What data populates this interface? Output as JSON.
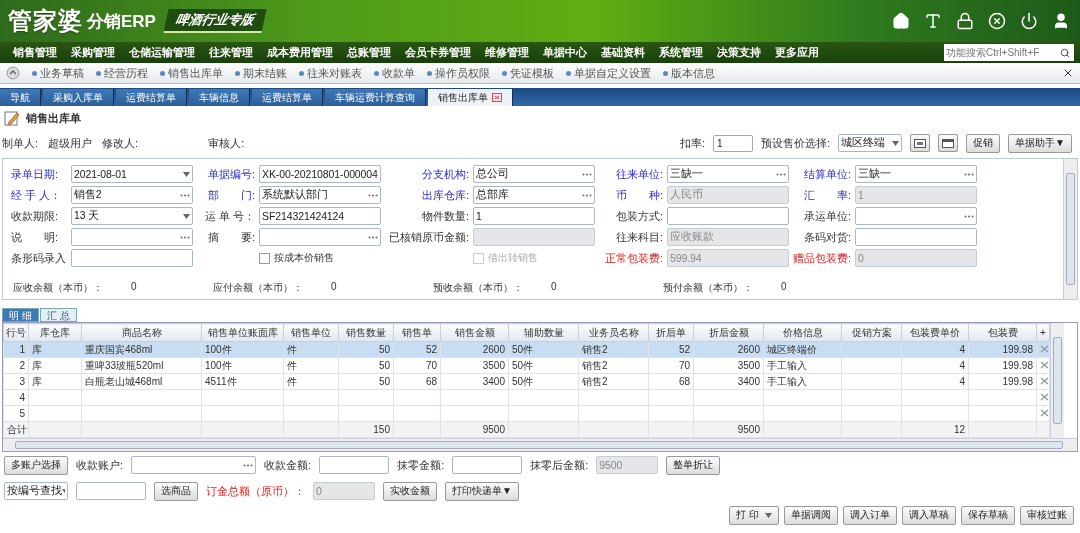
{
  "header": {
    "logo": "管家婆",
    "product": "分销ERP",
    "edition": "啤酒行业专版"
  },
  "menu": [
    "销售管理",
    "采购管理",
    "仓储运输管理",
    "往来管理",
    "成本费用管理",
    "总账管理",
    "会员卡券管理",
    "维修管理",
    "单据中心",
    "基础资料",
    "系统管理",
    "决策支持",
    "更多应用"
  ],
  "search": {
    "placeholder": "功能搜索Ctrl+Shift+F"
  },
  "quick_links": [
    "业务草稿",
    "经营历程",
    "销售出库单",
    "期末结账",
    "往来对账表",
    "收款单",
    "操作员权限",
    "凭证模板",
    "单据自定义设置",
    "版本信息"
  ],
  "tabs": [
    {
      "label": "导航",
      "selected": false,
      "closable": false
    },
    {
      "label": "采购入库单",
      "selected": false,
      "closable": false
    },
    {
      "label": "运费结算单",
      "selected": false,
      "closable": false
    },
    {
      "label": "车辆信息",
      "selected": false,
      "closable": false
    },
    {
      "label": "运费结算单",
      "selected": false,
      "closable": false
    },
    {
      "label": "车辆运费计算查询",
      "selected": false,
      "closable": false
    },
    {
      "label": "销售出库单",
      "selected": true,
      "closable": true
    }
  ],
  "document": {
    "title": "销售出库单",
    "creator_label": "制单人:",
    "creator": "超级用户",
    "modifier_label": "修改人:",
    "reviewer_label": "审核人:"
  },
  "toolbar": {
    "discount_label": "扣率:",
    "discount": "1",
    "price_label": "预设售价选择:",
    "price": "城区终端",
    "buttons": [
      "促销",
      "单据助手▼"
    ]
  },
  "form": {
    "rows": [
      {
        "cells": [
          {
            "label": "录单日期:",
            "required": true,
            "fee": false,
            "field": {
              "kind": "select",
              "value": "2021-08-01",
              "disabled": false
            }
          },
          {
            "label": "单据编号:",
            "required": true,
            "fee": false,
            "field": {
              "kind": "text",
              "value": "XK-00-20210801-000004",
              "disabled": false
            }
          },
          {
            "label": "分支机构:",
            "required": true,
            "fee": false,
            "field": {
              "kind": "picker",
              "value": "总公司",
              "disabled": false
            }
          },
          {
            "label": "往来单位:",
            "required": true,
            "fee": false,
            "field": {
              "kind": "picker",
              "value": "三缺一",
              "disabled": false
            }
          },
          {
            "label": "结算单位:",
            "required": true,
            "fee": false,
            "field": {
              "kind": "picker",
              "value": "三缺一",
              "disabled": false
            }
          }
        ]
      },
      {
        "cells": [
          {
            "label": "经 手 人：",
            "required": true,
            "fee": false,
            "field": {
              "kind": "picker",
              "value": "销售2",
              "disabled": false
            }
          },
          {
            "label": "部　　门:",
            "required": true,
            "fee": false,
            "field": {
              "kind": "picker",
              "value": "系统默认部门",
              "disabled": false
            }
          },
          {
            "label": "出库仓库:",
            "required": true,
            "fee": false,
            "field": {
              "kind": "picker",
              "value": "总部库",
              "disabled": false
            }
          },
          {
            "label": "币　　种:",
            "required": true,
            "fee": false,
            "field": {
              "kind": "select",
              "value": "人民币",
              "disabled": true
            }
          },
          {
            "label": "汇　　率:",
            "required": true,
            "fee": false,
            "field": {
              "kind": "text",
              "value": "1",
              "disabled": true
            }
          }
        ]
      },
      {
        "cells": [
          {
            "label": "收款期限:",
            "required": false,
            "fee": false,
            "field": {
              "kind": "select",
              "value": "13 天",
              "disabled": false
            }
          },
          {
            "label": "运 单 号：",
            "required": false,
            "fee": false,
            "field": {
              "kind": "text",
              "value": "SF214321424124",
              "disabled": false
            }
          },
          {
            "label": "物件数量:",
            "required": false,
            "fee": false,
            "field": {
              "kind": "text",
              "value": "1",
              "disabled": false
            }
          },
          {
            "label": "包装方式:",
            "required": false,
            "fee": false,
            "field": {
              "kind": "text",
              "disabled": false
            }
          },
          {
            "label": "承运单位:",
            "required": false,
            "fee": false,
            "field": {
              "kind": "picker",
              "disabled": false
            }
          }
        ]
      },
      {
        "cells": [
          {
            "label": "说　　明:",
            "required": false,
            "fee": false,
            "field": {
              "kind": "picker",
              "disabled": false
            }
          },
          {
            "label": "摘　　要:",
            "required": false,
            "fee": false,
            "field": {
              "kind": "picker",
              "disabled": false
            }
          },
          {
            "label": "已核销原币金额:",
            "required": false,
            "fee": false,
            "field": {
              "kind": "text",
              "disabled": true
            }
          },
          {
            "label": "往来科目:",
            "required": false,
            "fee": false,
            "field": {
              "kind": "select",
              "value": "应收账款",
              "disabled": true
            }
          },
          {
            "label": "条码对货:",
            "required": false,
            "fee": false,
            "field": {
              "kind": "text",
              "disabled": false
            }
          }
        ]
      },
      {
        "cells": [
          {
            "label": "条形码录入",
            "required": false,
            "fee": false,
            "field": {
              "kind": "text",
              "disabled": false
            }
          },
          {
            "field": {
              "kind": "checkbox",
              "label": "按成本价销售",
              "checked": false,
              "disabled": false
            }
          },
          {
            "field": {
              "kind": "checkbox",
              "label": "借出转销售",
              "checked": false,
              "disabled": true
            }
          },
          {
            "label": "正常包装费:",
            "required": false,
            "fee": true,
            "field": {
              "kind": "text",
              "value": "599.94",
              "disabled": true
            }
          },
          {
            "label": "赠品包装费:",
            "required": false,
            "fee": true,
            "field": {
              "kind": "text",
              "value": "0",
              "disabled": true
            }
          }
        ]
      }
    ]
  },
  "balances": [
    {
      "label": "应收余额（本币）：",
      "value": "0"
    },
    {
      "label": "应付余额（本币）：",
      "value": "0"
    },
    {
      "label": "预收余额（本币）：",
      "value": "0"
    },
    {
      "label": "预付余额（本币）：",
      "value": "0"
    }
  ],
  "detail_tabs": [
    {
      "label": "明 细",
      "selected": true
    },
    {
      "label": "汇 总",
      "selected": false
    }
  ],
  "table": {
    "columns": [
      "行号",
      "库仓库",
      "商品名称",
      "销售单位账面库",
      "销售单位",
      "销售数量",
      "销售单",
      "销售金额",
      "辅助数量",
      "业务员名称",
      "折后单",
      "折后金额",
      "价格信息",
      "促销方案",
      "包装费单价",
      "包装费",
      "+"
    ],
    "rows": [
      {
        "selected": true,
        "cells": [
          "1",
          "库",
          "重庆国宾468ml",
          "100件",
          "件",
          "50",
          "52",
          "2600",
          "50件",
          "销售2",
          "52",
          "2600",
          "城区终端价",
          null,
          "4",
          "199.98"
        ]
      },
      {
        "selected": false,
        "cells": [
          "2",
          "库",
          "重啤33玻瓶520ml",
          "100件",
          "件",
          "50",
          "70",
          "3500",
          "50件",
          "销售2",
          "70",
          "3500",
          "手工输入",
          null,
          "4",
          "199.98"
        ]
      },
      {
        "selected": false,
        "cells": [
          "3",
          "库",
          "白瓶老山城468ml",
          "4511件",
          "件",
          "50",
          "68",
          "3400",
          "50件",
          "销售2",
          "68",
          "3400",
          "手工输入",
          null,
          "4",
          "199.98"
        ]
      },
      {
        "selected": false,
        "cells": [
          "4"
        ]
      },
      {
        "selected": false,
        "cells": [
          "5"
        ]
      }
    ],
    "total": {
      "label": "合计",
      "销售数量": "150",
      "销售金额": "9500",
      "折后金额": "9500",
      "包装费单价": "12"
    }
  },
  "bottom_rows": [
    [
      {
        "kind": "button",
        "label": "多账户选择"
      },
      {
        "kind": "label",
        "text": "收款账户:"
      },
      {
        "kind": "picker",
        "disabled": false
      },
      {
        "kind": "label",
        "text": "收款金额:"
      },
      {
        "kind": "text",
        "disabled": false
      },
      {
        "kind": "label",
        "text": "抹零金额:"
      },
      {
        "kind": "text",
        "disabled": false
      },
      {
        "kind": "label",
        "text": "抹零后金额:"
      },
      {
        "kind": "text",
        "value": "9500",
        "disabled": true
      },
      {
        "kind": "button",
        "label": "整单折让"
      }
    ],
    [
      {
        "kind": "select",
        "value": "按编号查找",
        "disabled": false
      },
      {
        "kind": "text",
        "disabled": false
      },
      {
        "kind": "button",
        "label": "选商品"
      },
      {
        "kind": "label",
        "text": "订金总额（原币）：",
        "alert": true
      },
      {
        "kind": "text",
        "value": "0",
        "disabled": true
      },
      {
        "kind": "button",
        "label": "实收金额"
      },
      {
        "kind": "button",
        "label": "打印快递单▼"
      }
    ]
  ],
  "actions": [
    {
      "kind": "menu",
      "label": "打 印"
    },
    {
      "kind": "button",
      "label": "单据调阅"
    },
    {
      "kind": "button",
      "label": "调入订单"
    },
    {
      "kind": "button",
      "label": "调入草稿"
    },
    {
      "kind": "button",
      "label": "保存草稿"
    },
    {
      "kind": "button",
      "label": "审核过账"
    }
  ]
}
